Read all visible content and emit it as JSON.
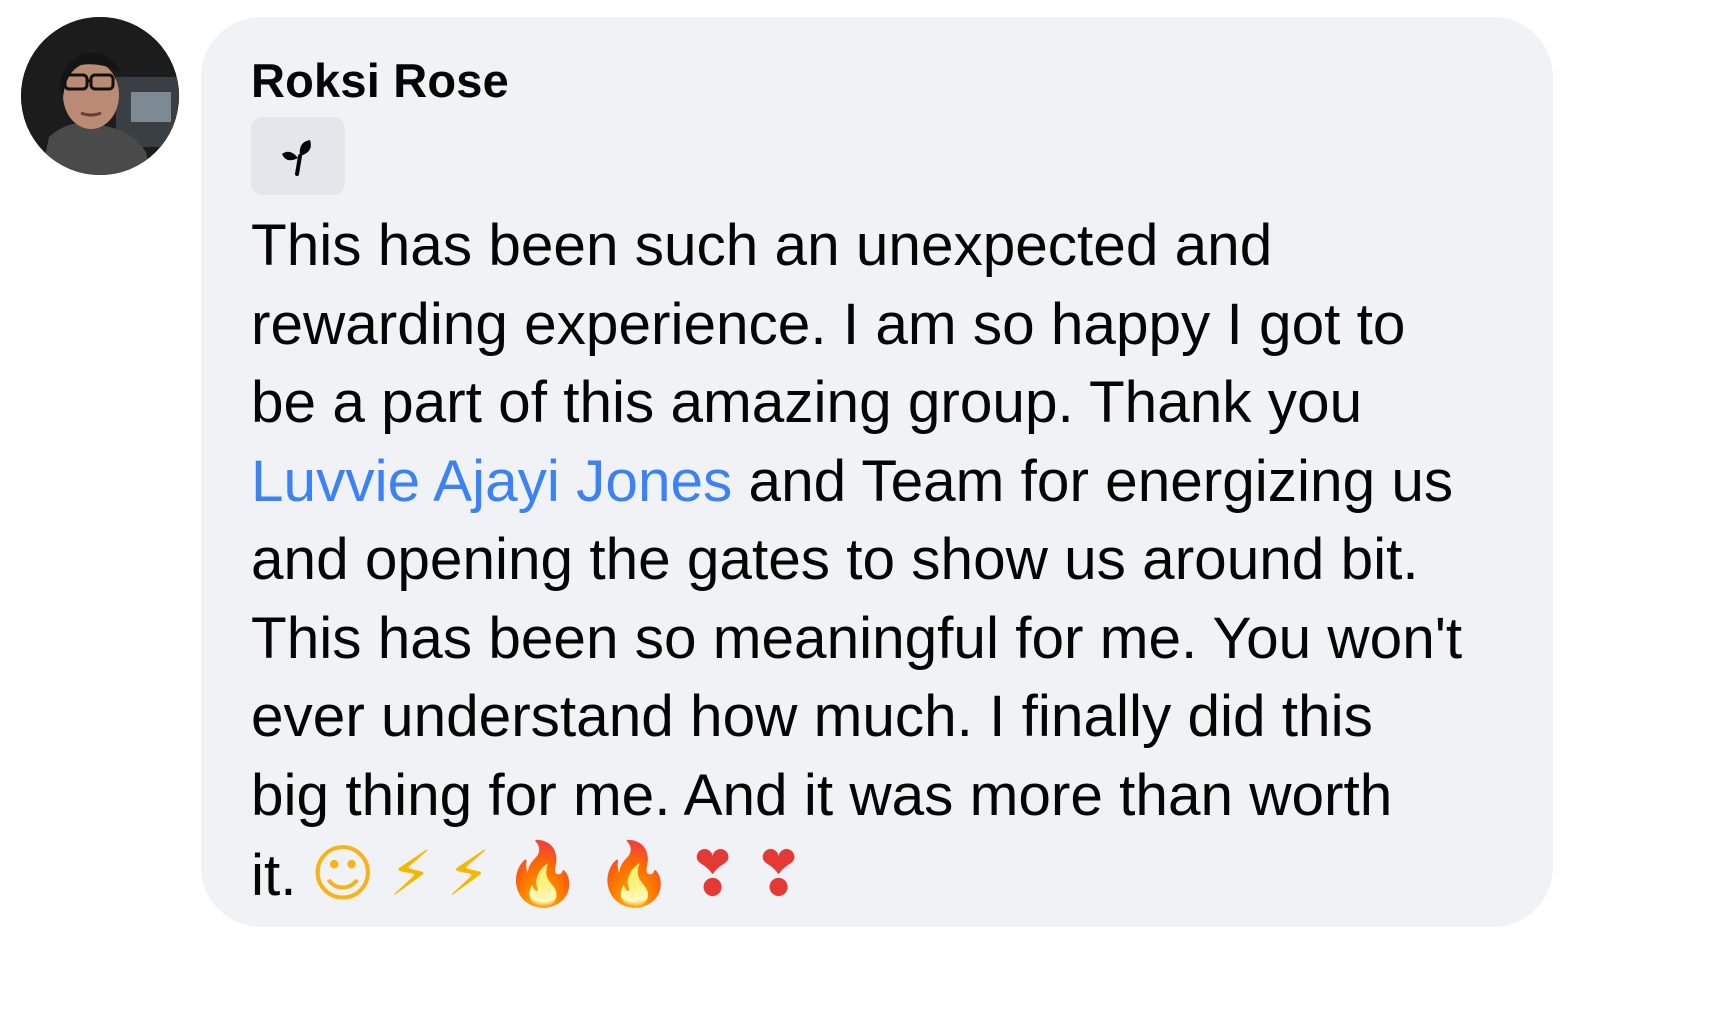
{
  "comment": {
    "author": "Roksi Rose",
    "badge_icon": "rising-sprout-icon",
    "lines": [
      {
        "text": "This has been such an unexpected and"
      },
      {
        "text": "rewarding experience. I am so happy I got to"
      },
      {
        "text": "be a part of this amazing group. Thank you"
      },
      {
        "mention": "Luvvie Ajayi Jones",
        "text": " and Team for energizing us"
      },
      {
        "text": "and opening the gates to show us around bit."
      },
      {
        "text": "This has been so meaningful for me. You won't"
      },
      {
        "text": "ever understand how much. I finally did this"
      },
      {
        "text": "big thing for me. And it was more than worth"
      },
      {
        "text": "it."
      }
    ],
    "emojis": [
      {
        "name": "smiling-face-with-hearts-icon",
        "glyph": "☺"
      },
      {
        "name": "lightning-icon",
        "glyph": "⚡"
      },
      {
        "name": "lightning-icon",
        "glyph": "⚡"
      },
      {
        "name": "fire-icon",
        "glyph": "🔥"
      },
      {
        "name": "fire-icon",
        "glyph": "🔥"
      },
      {
        "name": "heart-exclamation-icon",
        "glyph": "❣"
      },
      {
        "name": "heart-exclamation-icon",
        "glyph": "❣"
      }
    ]
  },
  "colors": {
    "bubble_bg": "#f0f2f5",
    "text": "#050505",
    "mention": "#3b82f6",
    "badge_bg": "#e4e6eb"
  }
}
